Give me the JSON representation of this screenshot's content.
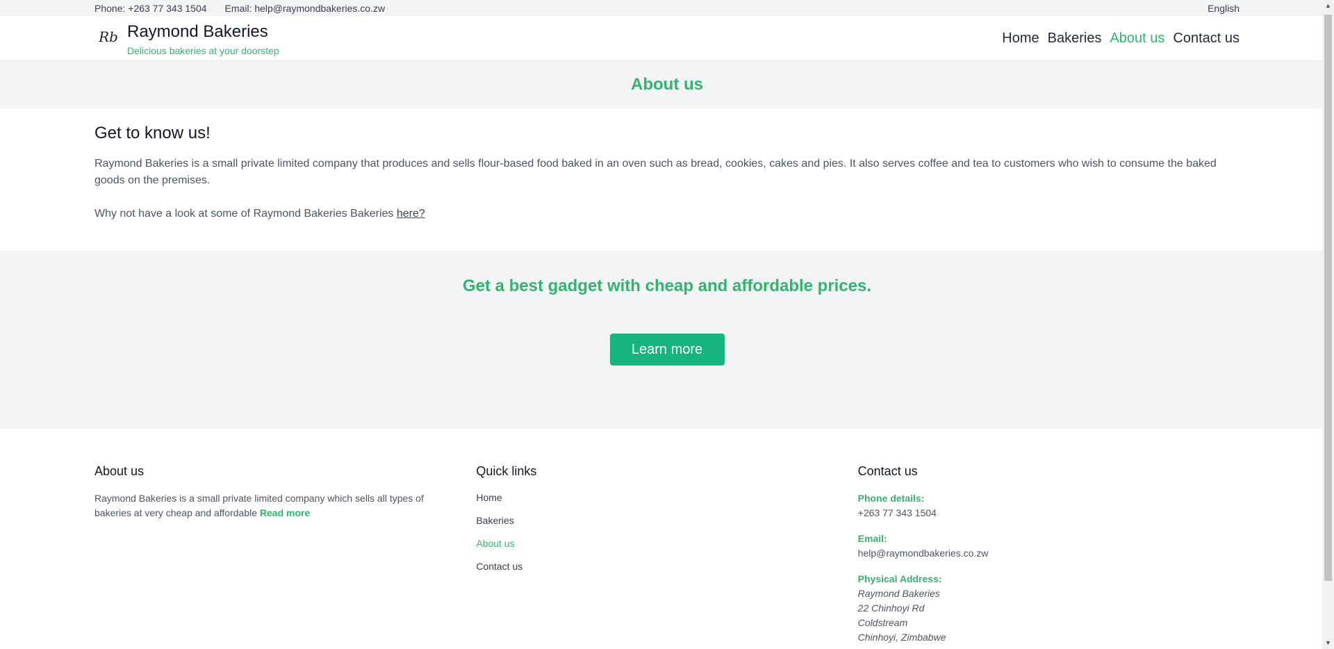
{
  "topbar": {
    "phone": "Phone: +263 77 343 1504",
    "email": "Email: help@raymondbakeries.co.zw",
    "language": "English"
  },
  "header": {
    "logo_text": "Rb",
    "brand_name": "Raymond Bakeries",
    "tagline": "Delicious bakeries at your doorstep",
    "nav": [
      {
        "label": "Home"
      },
      {
        "label": "Bakeries"
      },
      {
        "label": "About us"
      },
      {
        "label": "Contact us"
      }
    ]
  },
  "banner": {
    "title": "About us"
  },
  "about": {
    "heading": "Get to know us!",
    "paragraph": "Raymond Bakeries is a small private limited company that produces and sells flour-based food baked in an oven such as bread, cookies, cakes and pies. It also serves coffee and tea to customers who wish to consume the baked goods on the premises.",
    "prompt": "Why not have a look at some of Raymond Bakeries Bakeries ",
    "link": "here?"
  },
  "promo": {
    "heading": "Get a best gadget with cheap and affordable prices.",
    "button": "Learn more"
  },
  "footer": {
    "about": {
      "heading": "About us",
      "text": "Raymond Bakeries is a small private limited company which sells all types of bakeries at very cheap and affordable ",
      "readmore": "Read more"
    },
    "quicklinks": {
      "heading": "Quick links",
      "links": [
        {
          "label": "Home"
        },
        {
          "label": "Bakeries"
        },
        {
          "label": "About us"
        },
        {
          "label": "Contact us"
        }
      ]
    },
    "contact": {
      "heading": "Contact us",
      "phone_label": "Phone details:",
      "phone": "+263 77 343 1504",
      "email_label": "Email:",
      "email": "help@raymondbakeries.co.zw",
      "address_label": "Physical Address:",
      "address": [
        "Raymond Bakeries",
        "22 Chinhoyi Rd",
        "Coldstream",
        "Chinhoyi, Zimbabwe"
      ]
    }
  },
  "colors": {
    "accent": "#34b36f",
    "button": "#16b57e"
  }
}
